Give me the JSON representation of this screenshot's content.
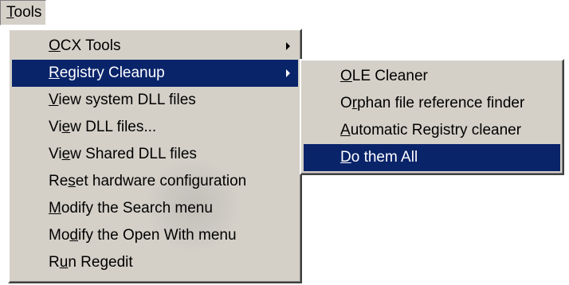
{
  "menubar": {
    "tools": {
      "prefix": "",
      "accel": "T",
      "suffix": "ools"
    }
  },
  "tools_menu": {
    "items": [
      {
        "prefix": "",
        "accel": "O",
        "suffix": "CX Tools",
        "submenu": true,
        "highlighted": false
      },
      {
        "prefix": "",
        "accel": "R",
        "suffix": "egistry Cleanup",
        "submenu": true,
        "highlighted": true
      },
      {
        "prefix": "",
        "accel": "V",
        "suffix": "iew system DLL files",
        "submenu": false,
        "highlighted": false
      },
      {
        "prefix": "Vi",
        "accel": "e",
        "suffix": "w DLL files...",
        "submenu": false,
        "highlighted": false
      },
      {
        "prefix": "Vi",
        "accel": "e",
        "suffix": "w Shared DLL files",
        "submenu": false,
        "highlighted": false
      },
      {
        "prefix": "Re",
        "accel": "s",
        "suffix": "et hardware configuration",
        "submenu": false,
        "highlighted": false
      },
      {
        "prefix": "",
        "accel": "M",
        "suffix": "odify the Search menu",
        "submenu": false,
        "highlighted": false
      },
      {
        "prefix": "Mo",
        "accel": "d",
        "suffix": "ify the Open With menu",
        "submenu": false,
        "highlighted": false
      },
      {
        "prefix": "R",
        "accel": "u",
        "suffix": "n Regedit",
        "submenu": false,
        "highlighted": false
      }
    ]
  },
  "registry_submenu": {
    "items": [
      {
        "prefix": "",
        "accel": "O",
        "suffix": "LE Cleaner",
        "highlighted": false
      },
      {
        "prefix": "O",
        "accel": "r",
        "suffix": "phan file reference finder",
        "highlighted": false
      },
      {
        "prefix": "",
        "accel": "A",
        "suffix": "utomatic Registry cleaner",
        "highlighted": false
      },
      {
        "prefix": "",
        "accel": "D",
        "suffix": "o them All",
        "highlighted": true
      }
    ]
  },
  "colors": {
    "menu_face": "#d4d0c8",
    "highlight": "#0a246a",
    "highlight_text": "#ffffff"
  }
}
